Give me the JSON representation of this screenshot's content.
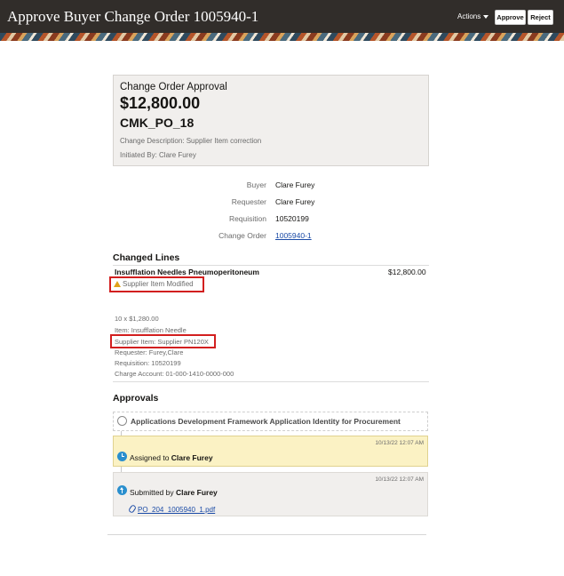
{
  "header": {
    "title": "Approve Buyer Change Order 1005940-1",
    "actions_label": "Actions",
    "approve_label": "Approve",
    "reject_label": "Reject"
  },
  "summary": {
    "label": "Change Order Approval",
    "amount": "$12,800.00",
    "po_number": "CMK_PO_18",
    "description": "Change Description: Supplier Item correction",
    "initiated_by": "Initiated By: Clare Furey"
  },
  "details": {
    "rows": [
      {
        "label": "Buyer",
        "value": "Clare Furey"
      },
      {
        "label": "Requester",
        "value": "Clare Furey"
      },
      {
        "label": "Requisition",
        "value": "10520199"
      },
      {
        "label": "Change Order",
        "value": "1005940-1"
      }
    ]
  },
  "changed_lines": {
    "title": "Changed Lines",
    "line_name": "Insufflation Needles Pneumoperitoneum",
    "line_amount": "$12,800.00",
    "warning": "Supplier Item Modified",
    "meta": [
      "10 x $1,280.00",
      "Item: Insufflation Needle",
      "Supplier Item: Supplier PN120X",
      "Requester: Furey,Clare",
      "Requisition: 10520199",
      "Charge Account: 01-000-1410-0000-000"
    ]
  },
  "approvals": {
    "title": "Approvals",
    "stage": "Applications Development Framework Application Identity for Procurement",
    "assigned": {
      "timestamp": "10/13/22 12:07 AM",
      "prefix": "Assigned to",
      "name": "Clare Furey"
    },
    "submitted": {
      "timestamp": "10/13/22 12:07 AM",
      "prefix": "Submitted by",
      "name": "Clare Furey",
      "attachment": "PO_204_1005940_1.pdf"
    }
  },
  "icons": {
    "warning": "warning-icon",
    "stage": "circle-icon",
    "assigned": "clock-icon",
    "submitted": "arrow-up-icon",
    "attachment": "paperclip-icon"
  },
  "colors": {
    "header_bg": "#312d2a",
    "highlight": "#d21f1f",
    "link": "#1a4aa6",
    "assigned_bg": "#fbf2c4",
    "status_icon": "#2a8fce"
  }
}
